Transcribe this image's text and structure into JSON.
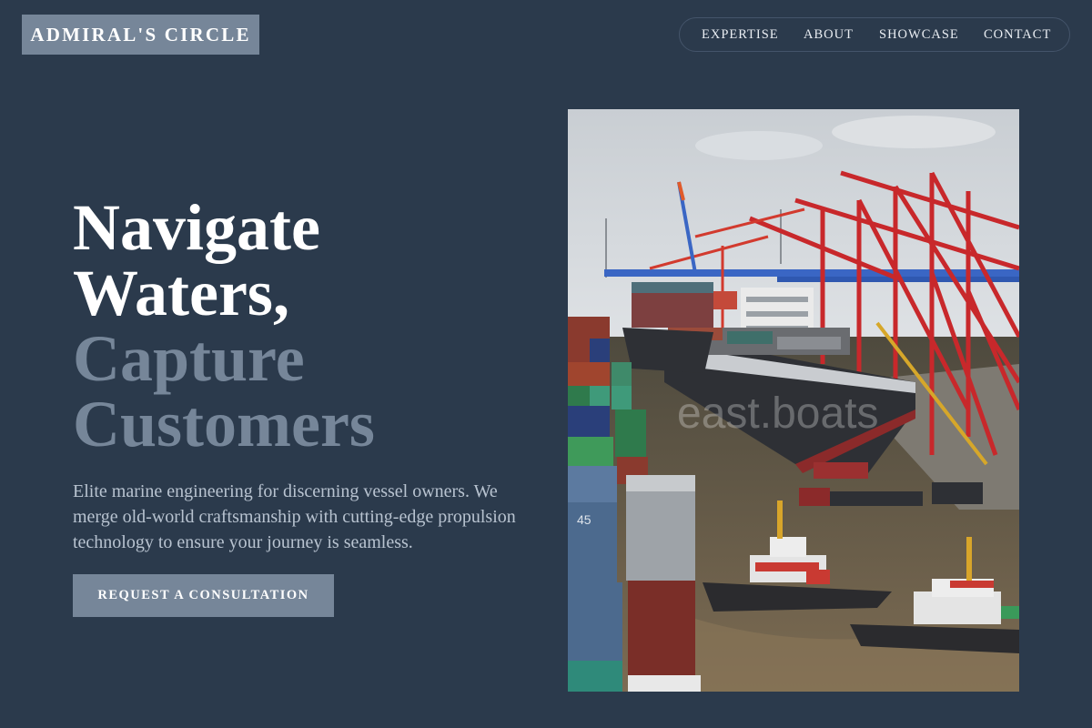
{
  "brand": {
    "logo_text": "ADMIRAL'S CIRCLE"
  },
  "nav": {
    "items": [
      "EXPERTISE",
      "ABOUT",
      "SHOWCASE",
      "CONTACT"
    ]
  },
  "hero": {
    "headline_line1": "Navigate",
    "headline_line2": "Waters,",
    "headline_line3": "Capture",
    "headline_line4": "Customers",
    "subtext": "Elite marine engineering for discerning vessel owners. We merge old-world craftsmanship with cutting-edge propulsion technology to ensure your journey is seamless.",
    "cta_label": "REQUEST A CONSULTATION",
    "image_watermark": "east.boats"
  },
  "colors": {
    "background": "#2b3a4c",
    "accent": "#768699",
    "text": "#ffffff",
    "muted_text": "#b8c3d0"
  }
}
